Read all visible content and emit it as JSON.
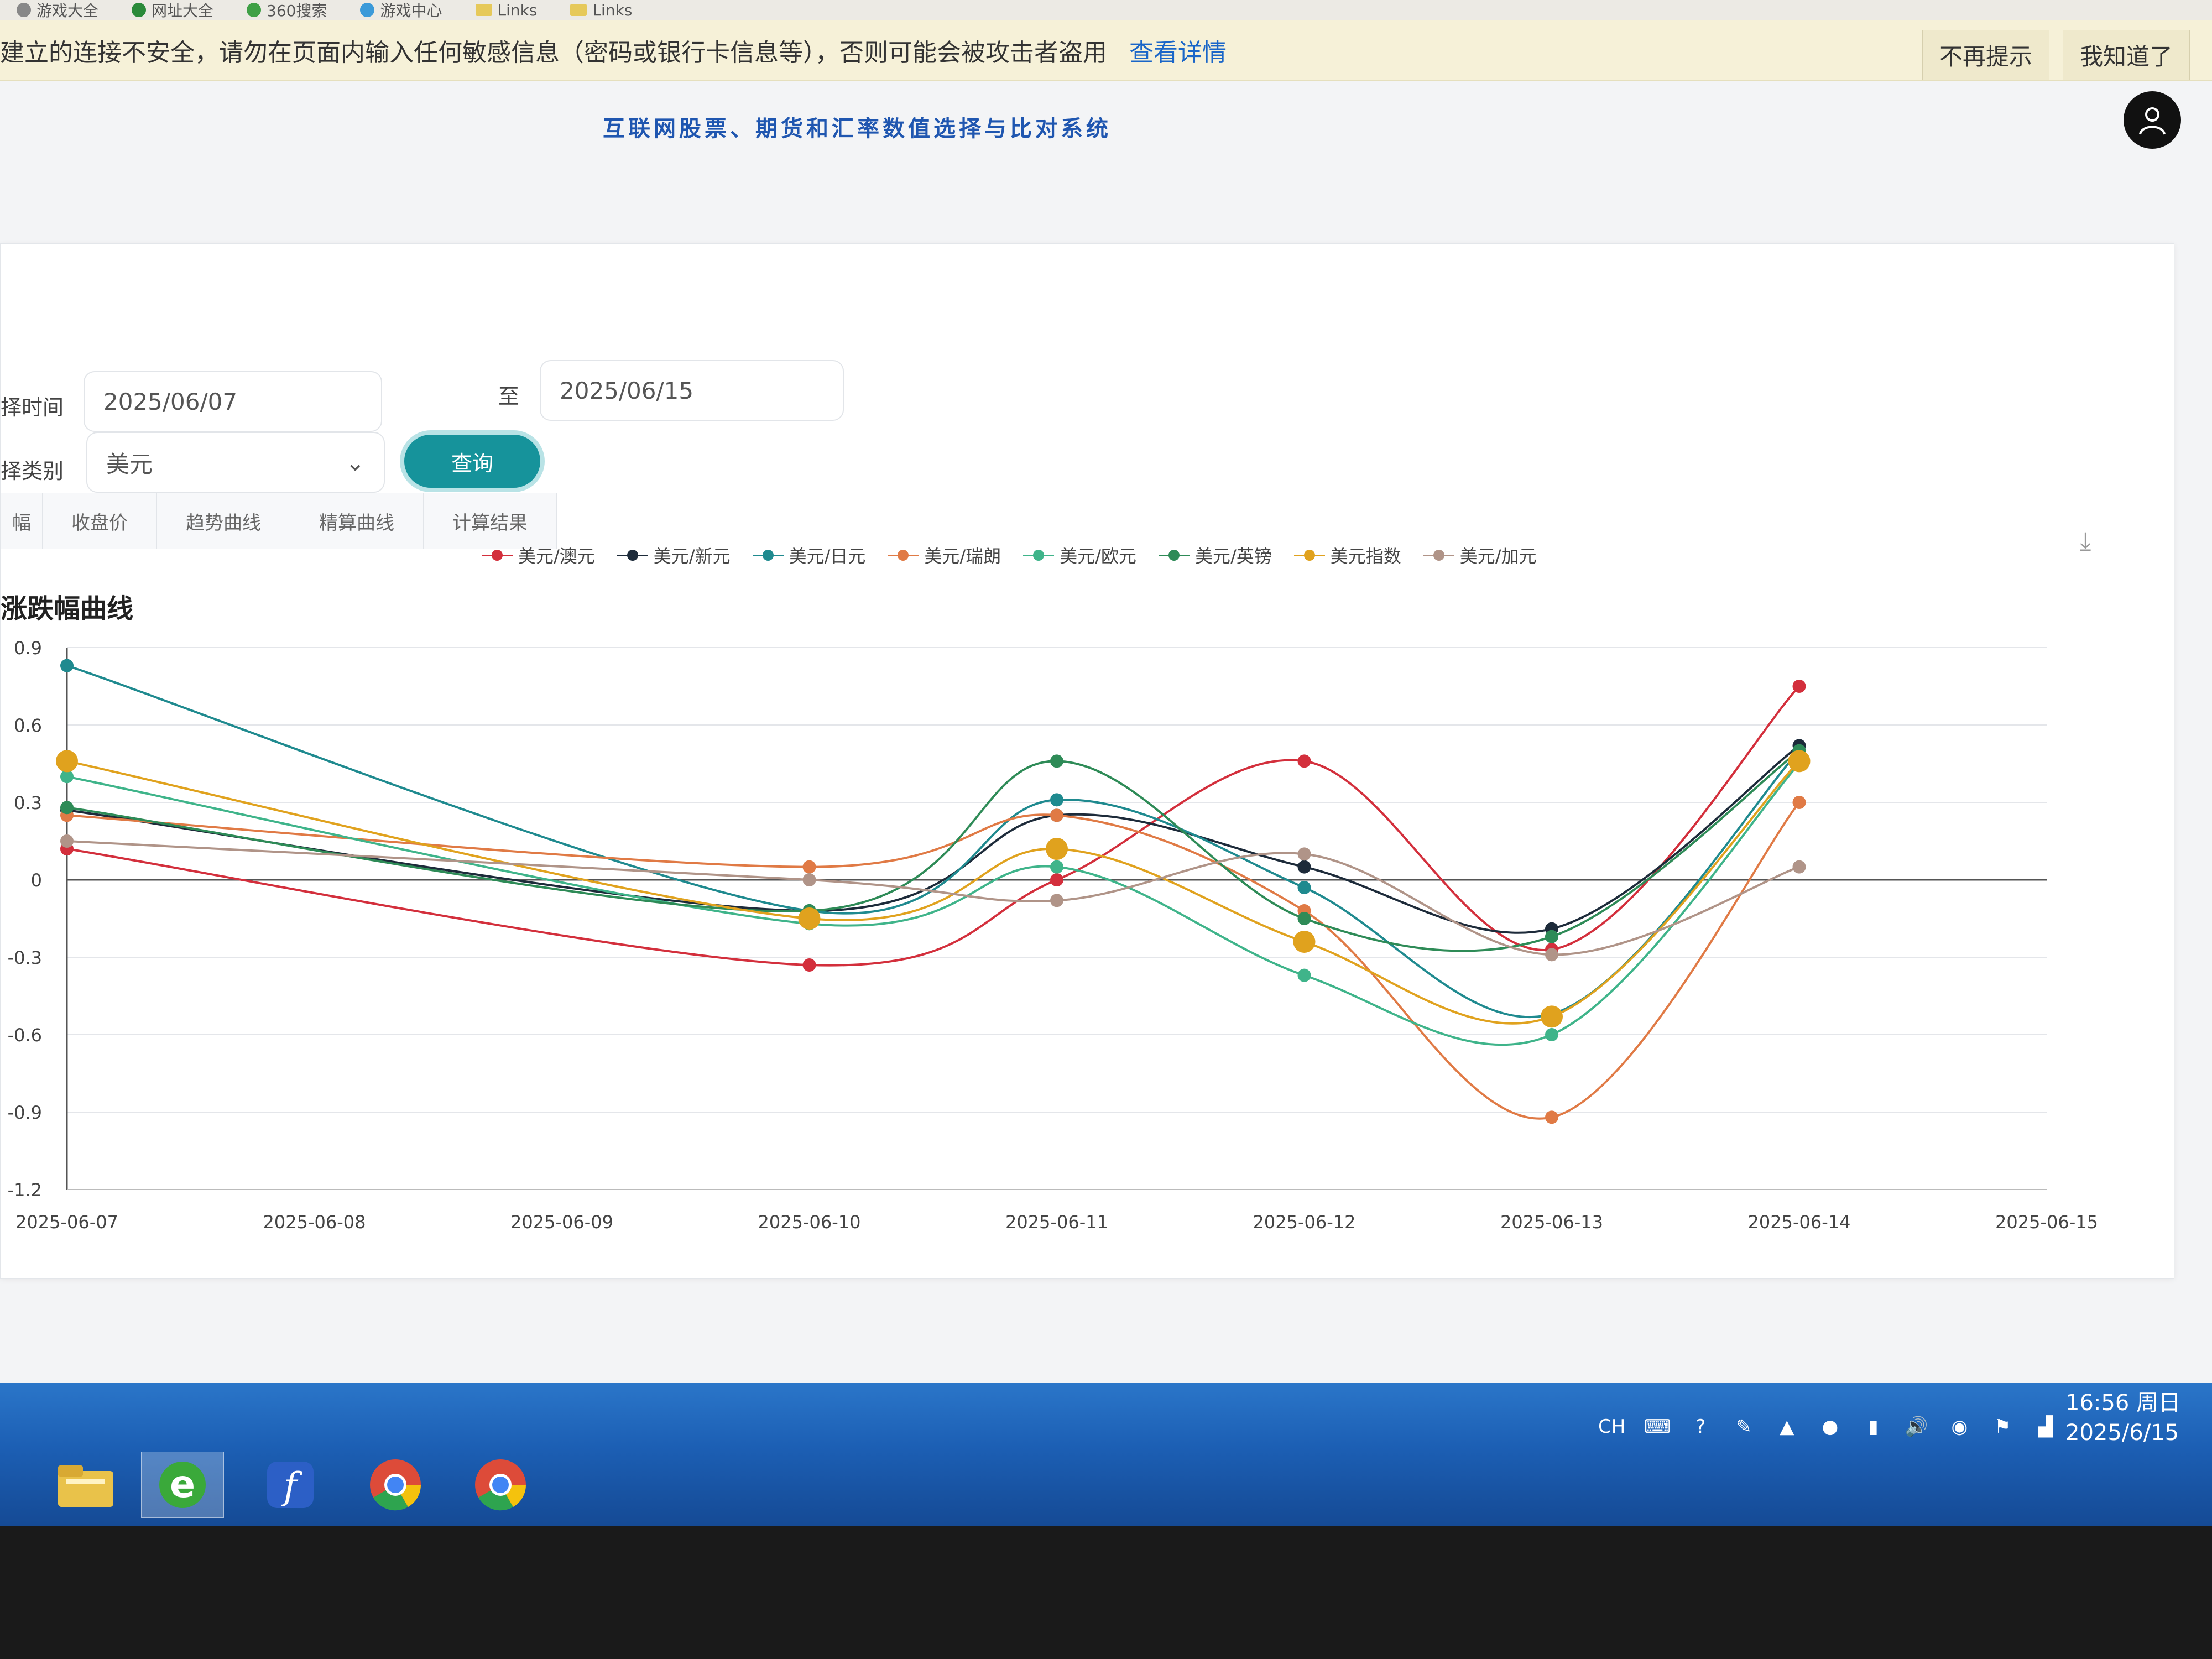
{
  "bookmarks": [
    {
      "label": "游戏大全"
    },
    {
      "label": "网址大全"
    },
    {
      "label": "360搜索"
    },
    {
      "label": "游戏中心"
    },
    {
      "label": "Links"
    },
    {
      "label": "Links"
    }
  ],
  "warning": {
    "message": "建立的连接不安全，请勿在页面内输入任何敏感信息（密码或银行卡信息等），否则可能会被攻击者盗用",
    "details_link": "查看详情",
    "dont_remind": "不再提示",
    "got_it": "我知道了"
  },
  "app_title": "互联网股票、期货和汇率数值选择与比对系统",
  "filters": {
    "time_label": "择时间",
    "start_date": "2025/06/07",
    "to_label": "至",
    "end_date": "2025/06/15",
    "category_label": "择类别",
    "category_value": "美元",
    "query_button": "查询"
  },
  "tabs": [
    "幅",
    "收盘价",
    "趋势曲线",
    "精算曲线",
    "计算结果"
  ],
  "chart_data": {
    "type": "line",
    "title": "涨跌幅曲线",
    "x": [
      "2025-06-07",
      "2025-06-08",
      "2025-06-09",
      "2025-06-10",
      "2025-06-11",
      "2025-06-12",
      "2025-06-13",
      "2025-06-14",
      "2025-06-15"
    ],
    "y_ticks": [
      "0.9",
      "0.6",
      "0.3",
      "0",
      "-0.3",
      "-0.6",
      "-0.9",
      "-1.2"
    ],
    "ylim": [
      -1.2,
      0.9
    ],
    "grid": true,
    "legend_position": "top",
    "series": [
      {
        "name": "美元/澳元",
        "color": "#d32f3c",
        "values": [
          0.12,
          null,
          null,
          -0.33,
          0.0,
          0.46,
          -0.27,
          0.75,
          null
        ]
      },
      {
        "name": "美元/新元",
        "color": "#1d2b3a",
        "values": [
          0.27,
          null,
          null,
          -0.12,
          0.25,
          0.05,
          -0.19,
          0.52,
          null
        ]
      },
      {
        "name": "美元/日元",
        "color": "#1f8a8f",
        "values": [
          0.83,
          null,
          null,
          -0.12,
          0.31,
          -0.03,
          -0.52,
          0.5,
          null
        ]
      },
      {
        "name": "美元/瑞朗",
        "color": "#e07a45",
        "values": [
          0.25,
          null,
          null,
          0.05,
          0.25,
          -0.12,
          -0.92,
          0.3,
          null
        ]
      },
      {
        "name": "美元/欧元",
        "color": "#3fb48a",
        "values": [
          0.4,
          null,
          null,
          -0.17,
          0.05,
          -0.37,
          -0.6,
          0.45,
          null
        ]
      },
      {
        "name": "美元/英镑",
        "color": "#2e8b57",
        "values": [
          0.28,
          null,
          null,
          -0.12,
          0.46,
          -0.15,
          -0.22,
          0.5,
          null
        ]
      },
      {
        "name": "美元指数",
        "color": "#e0a21e",
        "values": [
          0.46,
          null,
          null,
          -0.15,
          0.12,
          -0.24,
          -0.53,
          0.46,
          null
        ]
      },
      {
        "name": "美元/加元",
        "color": "#b09488",
        "values": [
          0.15,
          null,
          null,
          0.0,
          -0.08,
          0.1,
          -0.29,
          0.05,
          null
        ]
      }
    ]
  },
  "taskbar": {
    "lang": "CH",
    "time": "16:56 周日",
    "date": "2025/6/15"
  }
}
